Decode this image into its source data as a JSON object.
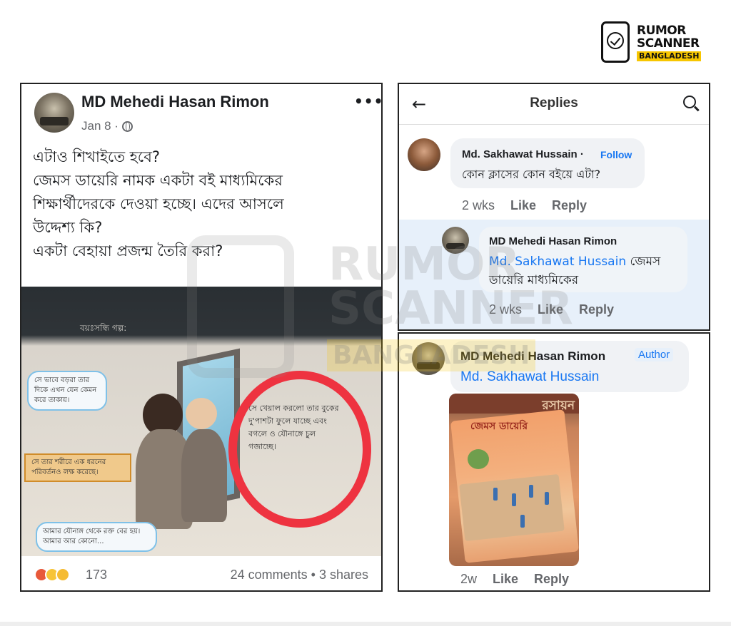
{
  "logo": {
    "line1": "RUMOR",
    "line2": "SCANNER",
    "line3": "BANGLADESH"
  },
  "watermark": {
    "line1": "RUMOR",
    "line2": "SCANNER",
    "line3": "BANGLADESH"
  },
  "post": {
    "author": "MD Mehedi Hasan Rimon",
    "date": "Jan 8 ·",
    "privacy_icon": "globe-icon",
    "more_icon": "•••",
    "text_lines": [
      "এটাও শিখাইতে হবে?",
      "জেমস ডায়েরি নামক একটা বই মাধ্যমিকের",
      "শিক্ষার্থীদেরকে দেওয়া হচ্ছে। এদের আসলে",
      "উদ্দেশ্য কি?",
      "একটা বেহায়া প্রজন্ম তৈরি করা?"
    ],
    "image": {
      "heading": "বয়ঃসন্ধি গল্প:",
      "bubble_top": "সে ভাবে বড়রা তার দিকে এখন যেন কেমন করে তাকায়।",
      "arrow_text": "সে তার শরীরে এক ধরনের পরিবর্তনও লক্ষ করেছে।",
      "circled_text": "সে খেয়াল করলো তার বুকের দু'পাশটা ফুলে যাচ্ছে এবং বগলে ও যৌনাঙ্গে চুল গজাচ্ছে।",
      "bubble_bottom": "আমার যৌনাঙ্গ থেকে রক্ত বের হয়। আমার আর কোনো..."
    },
    "reaction_count": "173",
    "reactions": [
      "angry",
      "haha",
      "sad"
    ],
    "engagement": "24 comments • 3 shares"
  },
  "replies": {
    "header_title": "Replies",
    "comment1": {
      "author": "Md. Sakhawat Hussain ·",
      "follow_label": "Follow",
      "text": "কোন ক্লাসের কোন বইয়ে এটা?",
      "time": "2 wks",
      "like_label": "Like",
      "reply_label": "Reply"
    },
    "comment2": {
      "author": "MD Mehedi Hasan Rimon",
      "mention": "Md. Sakhawat Hussain",
      "text": " জেমস ডায়েরি মাধ্যমিকের",
      "time": "2 wks",
      "like_label": "Like",
      "reply_label": "Reply"
    }
  },
  "thread": {
    "author": "MD Mehedi Hasan Rimon",
    "badge": "Author",
    "mention": "Md. Sakhawat Hussain",
    "photo": {
      "strip_title": "রসায়ন",
      "book_title": "জেমস ডায়েরি"
    },
    "time": "2w",
    "like_label": "Like",
    "reply_label": "Reply"
  }
}
